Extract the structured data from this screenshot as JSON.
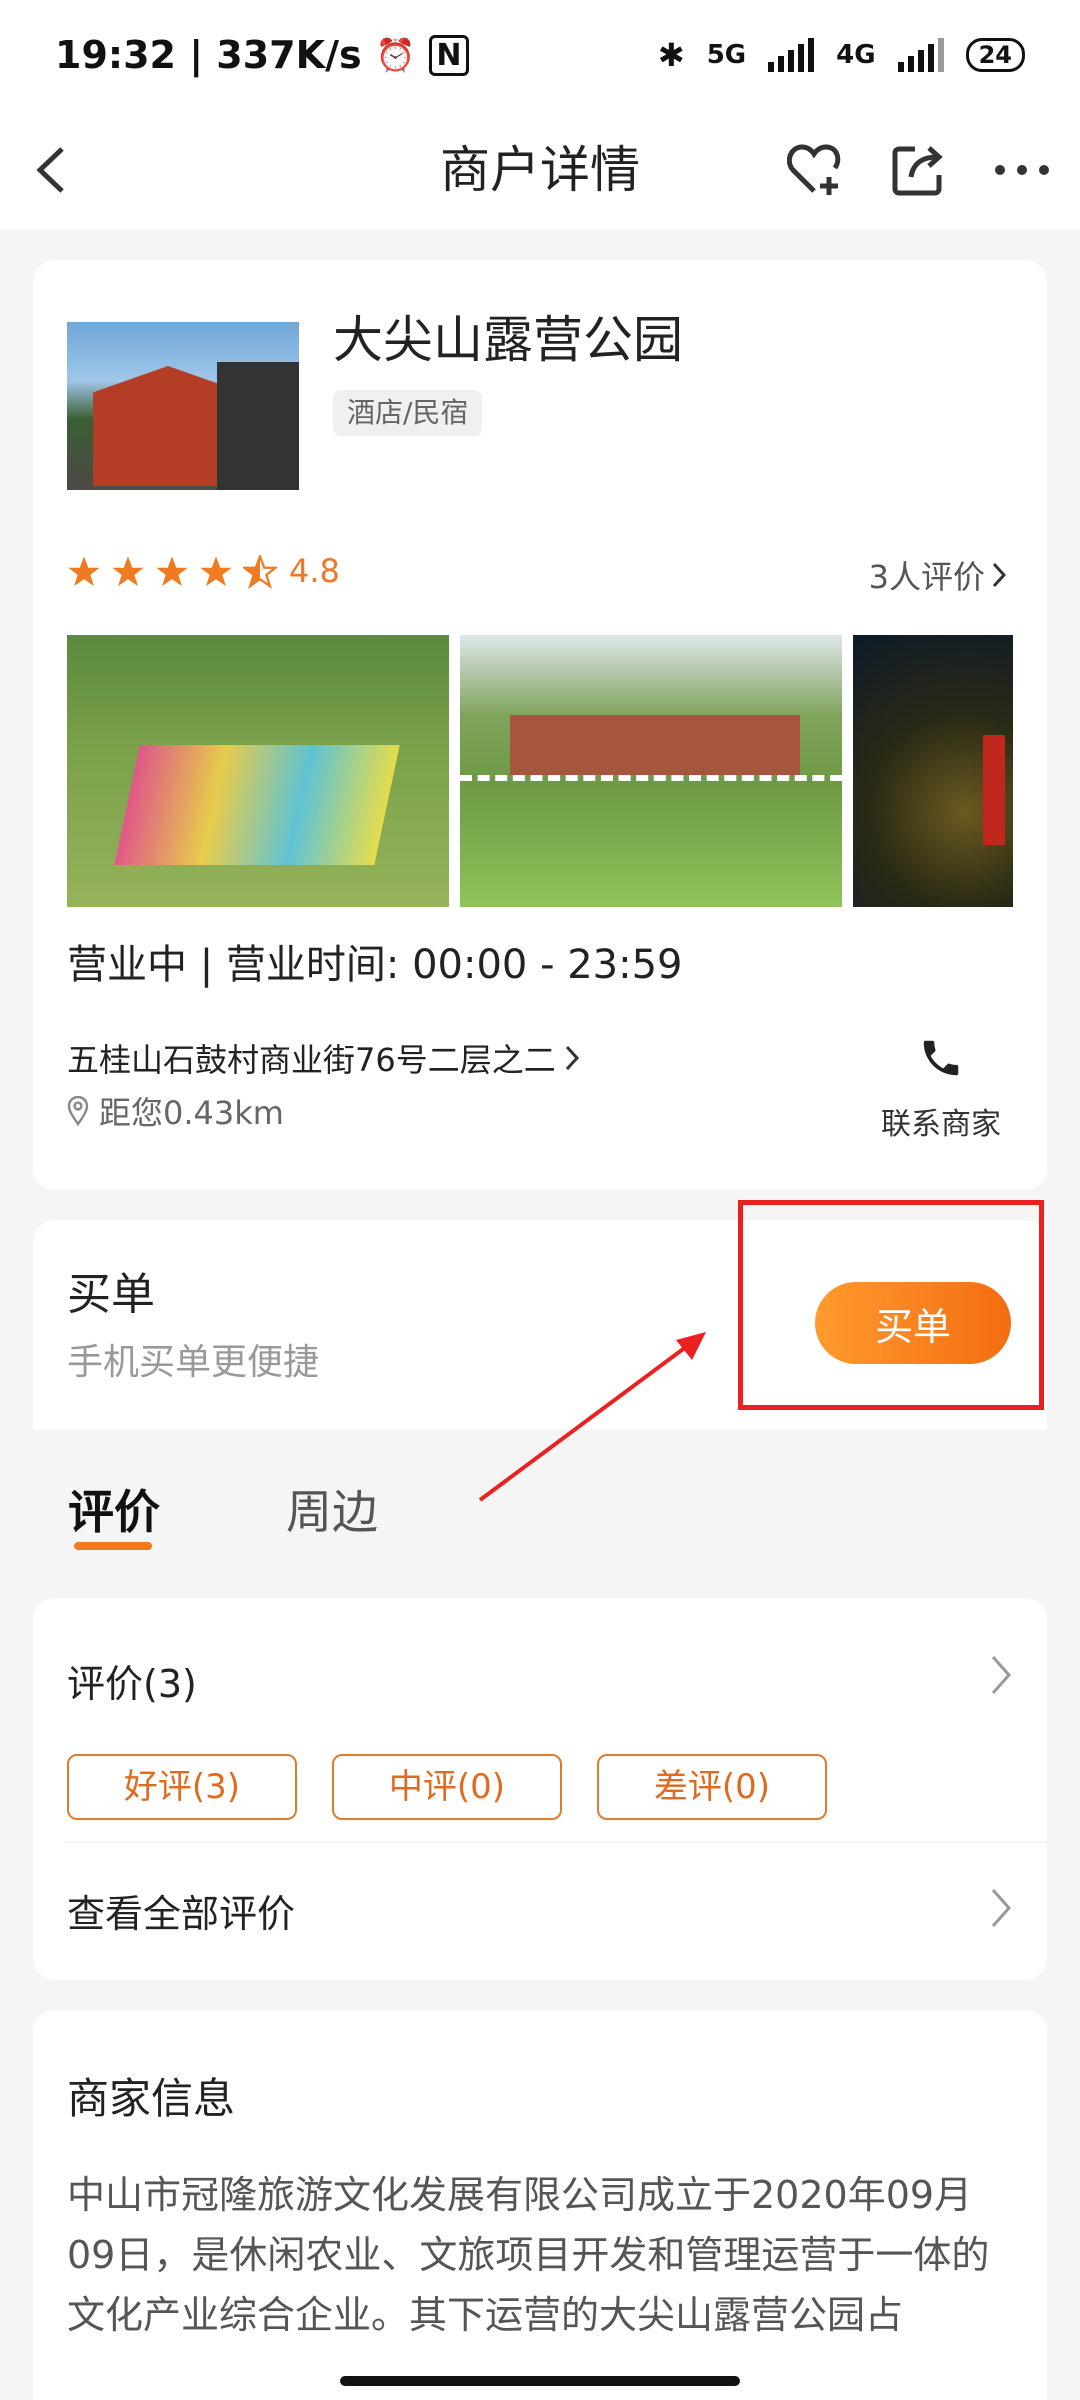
{
  "status_bar": {
    "time": "19:32 | 337K/s",
    "net1": "5G",
    "net2": "4G",
    "battery": "24"
  },
  "nav": {
    "title": "商户详情"
  },
  "merchant": {
    "name": "大尖山露营公园",
    "category": "酒店/民宿",
    "rating": "4.8",
    "star_count": 4.5,
    "reviews_link": "3人评价",
    "hours": "营业中 | 营业时间:  00:00 - 23:59",
    "address": "五桂山石鼓村商业街76号二层之二",
    "distance": "距您0.43km",
    "contact_label": "联系商家"
  },
  "buy": {
    "title": "买单",
    "subtitle": "手机买单更便捷",
    "button_label": "买单"
  },
  "tabs": [
    {
      "label": "评价"
    },
    {
      "label": "周边"
    }
  ],
  "reviews": {
    "title": "评价(3)",
    "filters": [
      {
        "label": "好评(3)"
      },
      {
        "label": "中评(0)"
      },
      {
        "label": "差评(0)"
      }
    ],
    "view_all": "查看全部评价"
  },
  "merchant_info": {
    "title": "商家信息",
    "text": "中山市冠隆旅游文化发展有限公司成立于2020年09月09日，是休闲农业、文旅项目开发和管理运营于一体的文化产业综合企业。其下运营的大尖山露营公园占"
  },
  "colors": {
    "accent": "#f07a20",
    "highlight": "#ec2020",
    "button_start": "#ff9a2e",
    "button_end": "#f46d11"
  }
}
